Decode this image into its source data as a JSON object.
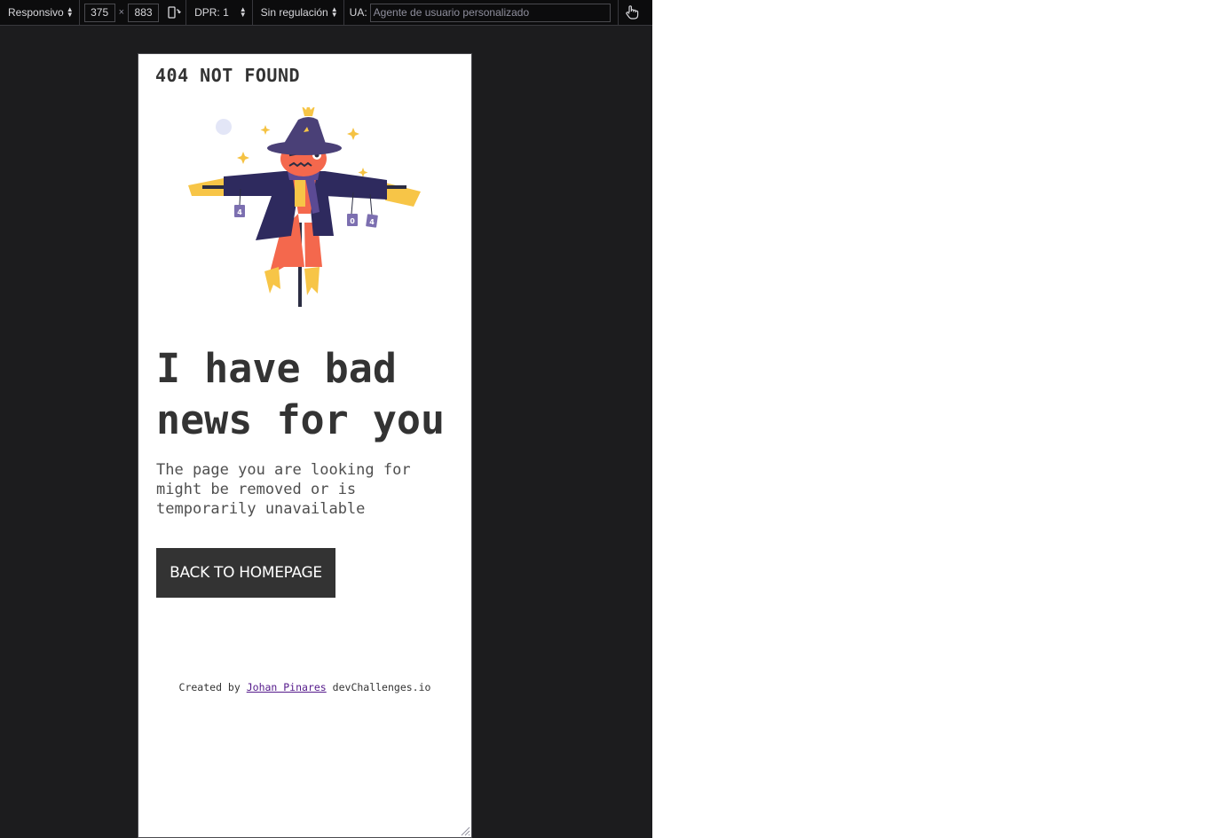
{
  "devtools": {
    "device_select": "Responsivo",
    "width": "375",
    "times": "×",
    "height": "883",
    "dpr_select": "DPR: 1",
    "throttle_select": "Sin regulación",
    "ua_label": "UA:",
    "ua_placeholder": "Agente de usuario personalizado",
    "icons": {
      "rotate": "rotate-device-icon",
      "touch": "touch-simulation-icon"
    }
  },
  "page": {
    "brand": "404 NOT FOUND",
    "illustration": "scarecrow-illustration",
    "headline_line1": "I have bad",
    "headline_line2": "news for you",
    "subtext_line1": "The page you are looking for",
    "subtext_line2": "might be removed or is",
    "subtext_line3": "temporarily unavailable",
    "cta_label": "BACK TO HOMEPAGE",
    "footer_prefix": "Created by",
    "footer_link": "Johan Pinares",
    "footer_suffix": "devChallenges.io",
    "colors": {
      "text": "#333333",
      "button_bg": "#333333",
      "link": "#551a8b"
    }
  }
}
